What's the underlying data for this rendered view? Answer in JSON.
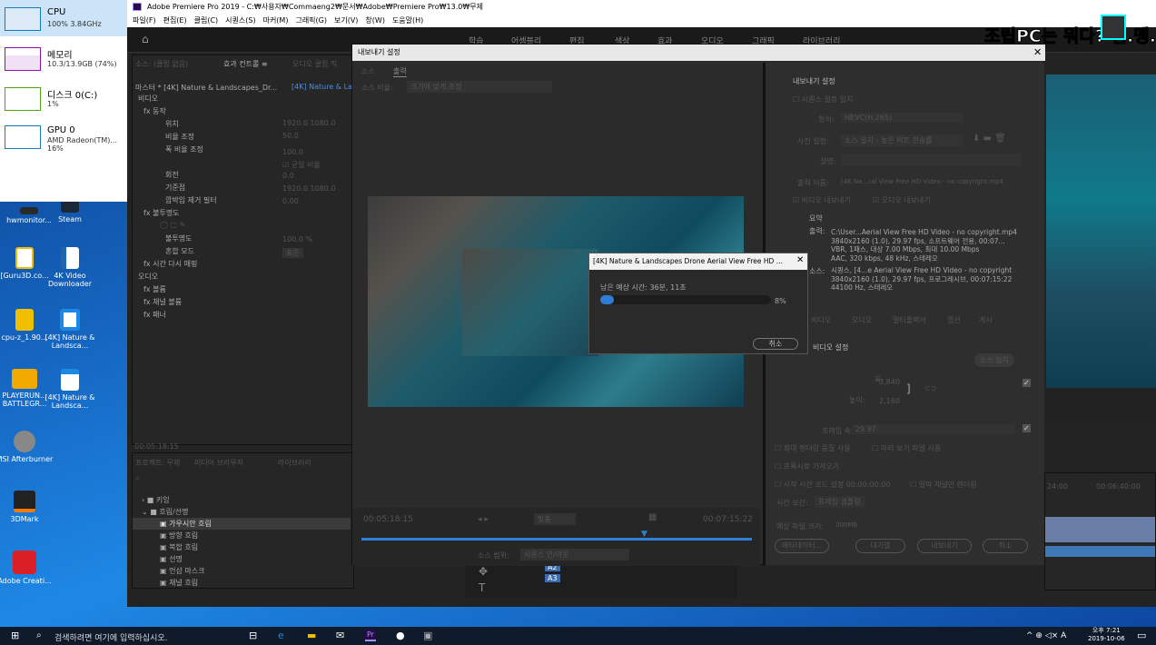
{
  "taskmanager": {
    "cpu_label": "CPU",
    "cpu_value": "100% 3.84GHz",
    "mem_label": "메모리",
    "mem_value": "10.3/13.9GB (74%)",
    "disk_label": "디스크 0(C:)",
    "disk_value": "1%",
    "gpu_label": "GPU 0",
    "gpu_name": "AMD Radeon(TM)...",
    "gpu_value": "16%"
  },
  "desktop_icons": [
    "hwmonitor...",
    "Steam",
    "[Guru3D.co...",
    "4K Video Downloader",
    "cpu-z_1.90...",
    "[4K] Nature & Landsca...",
    "PLAYERUN... BATTLEGR...",
    "[4K] Nature & Landsca...",
    "MSI Afterburner",
    "3DMark",
    "Adobe Creati..."
  ],
  "app": {
    "title": "Adobe Premiere Pro 2019 - C:₩사용자₩Commaeng2₩문서₩Adobe₩Premiere Pro₩13.0₩무제",
    "menu": [
      "파일(F)",
      "편집(E)",
      "클립(C)",
      "시퀀스(S)",
      "마커(M)",
      "그래픽(G)",
      "보기(V)",
      "창(W)",
      "도움말(H)"
    ],
    "workspaces": [
      "학습",
      "어셈블리",
      "편집",
      "색상",
      "효과",
      "오디오",
      "그래픽",
      "라이브러리"
    ],
    "banner": "조립PC는 뭐다? 컴.맹.닷.컴"
  },
  "effects": {
    "tabs": [
      "소스: (클립 없음)",
      "효과 컨트롤 ≡",
      "오디오 클립 믹"
    ],
    "clip": "마스터 * [4K] Nature & Landscapes_Dr...",
    "clip2": "[4K] Nature & Land",
    "rows": [
      "비디오",
      "fx 동작",
      "위치",
      "비율 조정",
      "폭 비율 조정",
      "",
      "회전",
      "기준점",
      "깜박임 제거 필터",
      "fx 불투명도",
      "",
      "불투명도",
      "혼합 모드",
      "fx 시간 다시 매핑",
      "오디오",
      "fx 볼륨",
      "fx 채널 볼륨",
      "fx 패너"
    ],
    "values": [
      "1920.0  1080.0",
      "50.0",
      "100.0",
      "☑ 균일 비율",
      "0.0",
      "1920.0  1080.0",
      "0.00",
      "100.0 %",
      "표준"
    ],
    "time": "00:05:18:15"
  },
  "project": {
    "tabs": [
      "프로젝트: 무제",
      "미디어 브라우저",
      "라이브러리"
    ],
    "items": [
      "키잉",
      "흐림/선명",
      "가우시안 흐림",
      "방향 흐림",
      "복합 흐림",
      "선명",
      "언샵 마스크",
      "채널 흐림"
    ]
  },
  "dialog": {
    "title": "내보내기 설정",
    "tabs": [
      "소스",
      "출력"
    ],
    "source_scale_label": "소스 비율:",
    "source_scale": "크기에 맞게 조정",
    "tc_in": "00:05:18:15",
    "tc_out": "00:07:15:22",
    "fit": "맞춤",
    "range_label": "소스 범위:",
    "range": "시퀀스 인/아웃",
    "settings": {
      "header": "내보내기 설정",
      "match": "시퀀스 설정 일치",
      "format_label": "형식:",
      "format": "HEVC(H.265)",
      "preset_label": "사전 설정:",
      "preset": "소스 일치 - 높은 비트 전송률",
      "comment_label": "설명:",
      "output_label": "출력 이름:",
      "output_name": "[4K Na...ral View   Free HD Video - no copyright.mp4",
      "export_video": "비디오 내보내기",
      "export_audio": "오디오 내보내기",
      "summary": "요약",
      "output_key": "출력:",
      "output_lines": [
        "C:\\User...Aerial View   Free HD Video - no copyright.mp4",
        "3840x2160 (1.0), 29.97 fps, 소프트웨어 전용, 00:07...",
        "VBR, 1패스, 대상 7.00 Mbps, 최대 10.00 Mbps",
        "AAC, 320 kbps, 48 kHz, 스테레오"
      ],
      "source_key": "소스:",
      "source_lines": [
        "시퀀스, [4...e Aerial View   Free HD Video - no copyright",
        "3840x2160 (1.0), 29.97 fps, 프로그레시브, 00:07:15:22",
        "44100 Hz, 스테레오"
      ],
      "tabs2": [
        "비디오",
        "오디오",
        "멀티플렉서",
        "캡션",
        "게시"
      ],
      "video_settings": "비디오 설정",
      "match_source": "소스 일치",
      "width_label": "폭:",
      "width": "3,840",
      "height_label": "높이:",
      "height": "2,160",
      "framerate_label": "프레임 속도:",
      "framerate": "29.97",
      "opt1": "최대 렌더링 품질 사용",
      "opt2": "미리 보기 파일 사용",
      "opt3": "프록시로 가져오기",
      "opt4": "시작 시간 코드 설정",
      "opt4_tc": "00:00:00:00",
      "opt5": "알파 채널만 렌더링",
      "interp_label": "시간 보간:",
      "interp": "프레임 샘플링",
      "filesize_label": "예상 파일 크기:",
      "filesize": "300MB",
      "btns": [
        "메타데이터...",
        "대기열",
        "내보내기",
        "취소"
      ]
    }
  },
  "progress": {
    "title": "[4K] Nature & Landscapes   Drone Aerial View   Free HD ...",
    "remaining": "남은 예상 시간: 36분, 11초",
    "percent": "8%",
    "percent_value": 0.08,
    "cancel": "취소"
  },
  "timeline": {
    "tc1": "24:00",
    "tc2": "00:06:40:00",
    "tracks": [
      "A2",
      "A3"
    ]
  },
  "taskbar": {
    "search": "검색하려면 여기에 입력하십시오.",
    "time": "오후 7:21",
    "date": "2019-10-06",
    "ime": "A"
  }
}
